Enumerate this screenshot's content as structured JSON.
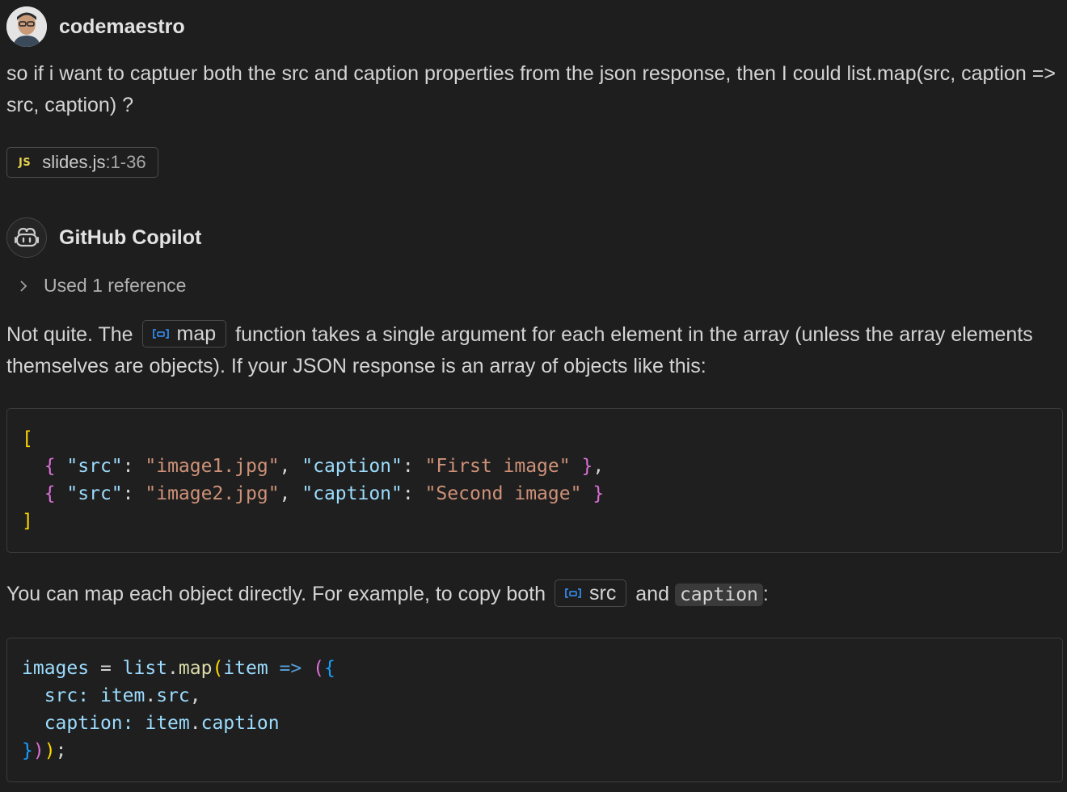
{
  "user_message": {
    "username": "codemaestro",
    "text": "so if i want to captuer both the src and caption properties from the json response, then I could list.map(src, caption => src, caption) ?",
    "attachment": {
      "badge": "JS",
      "filename": "slides.js",
      "range": ":1-36"
    }
  },
  "assistant_message": {
    "name": "GitHub Copilot",
    "references_label": "Used 1 reference",
    "para1": {
      "before": "Not quite. The",
      "symbol": "map",
      "after": "function takes a single argument for each element in the array (unless the array elements themselves are objects). If your JSON response is an array of objects like this:"
    },
    "code1": {
      "open_bracket": "[",
      "rows": [
        {
          "src": "\"image1.jpg\"",
          "caption": "\"First image\"",
          "trail": ","
        },
        {
          "src": "\"image2.jpg\"",
          "caption": "\"Second image\"",
          "trail": ""
        }
      ],
      "close_bracket": "]",
      "src_key": "\"src\"",
      "caption_key": "\"caption\""
    },
    "para2": {
      "before": "You can map each object directly. For example, to copy both",
      "symbol": "src",
      "middle": "and",
      "inline_code": "caption",
      "after": ":"
    },
    "code2": {
      "var": "images",
      "obj": "list",
      "method": "map",
      "param": "item",
      "src_prop": "src",
      "caption_prop": "caption"
    }
  },
  "colors": {
    "background": "#1e1e1e",
    "js_badge": "#e8d44d",
    "symbol_icon": "#3794ff"
  }
}
